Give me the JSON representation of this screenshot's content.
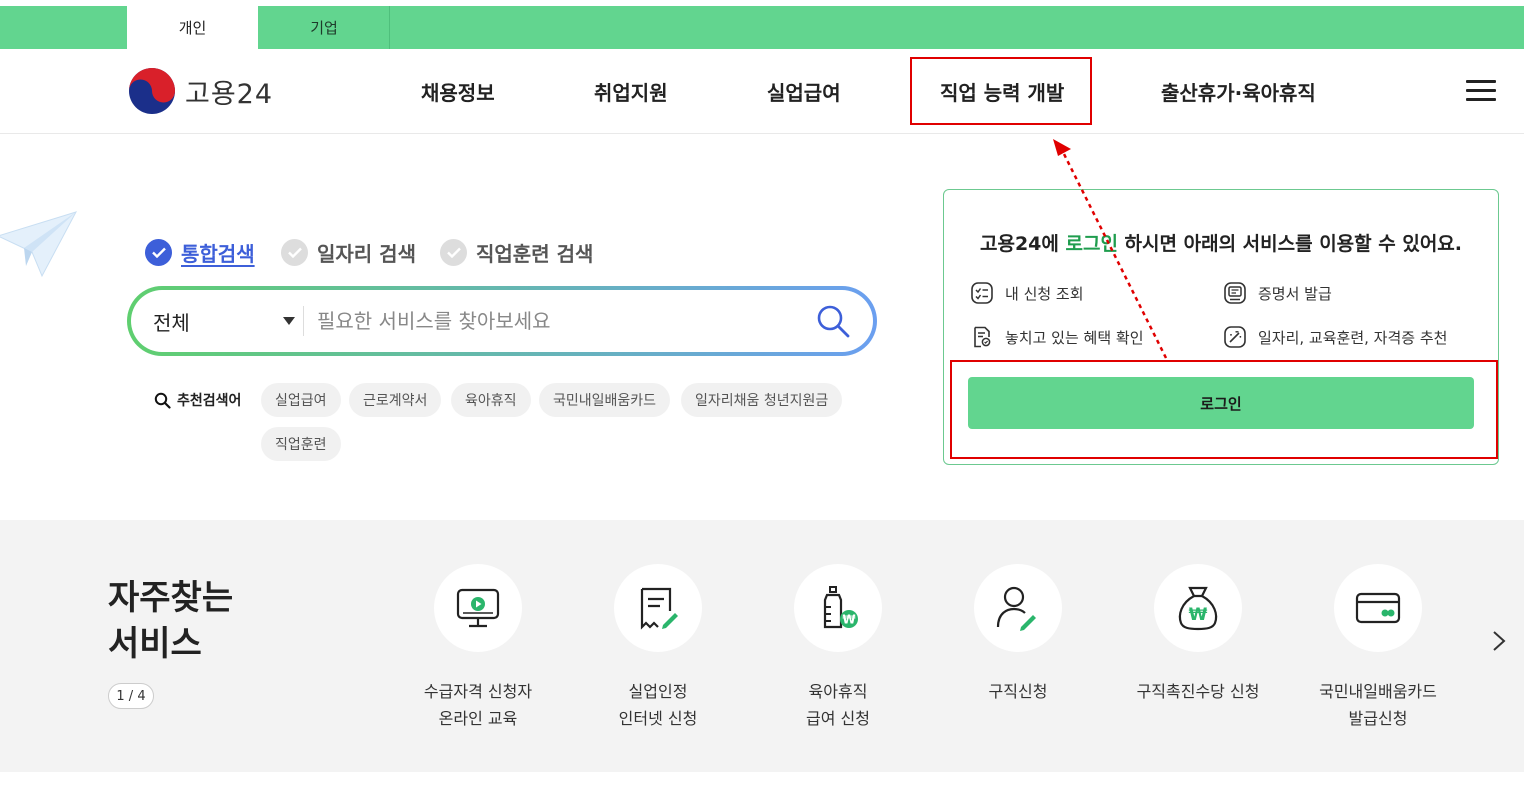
{
  "top_tabs": [
    {
      "label": "개인",
      "active": true
    },
    {
      "label": "기업",
      "active": false
    }
  ],
  "header": {
    "logo_text": "고용24",
    "nav": [
      "채용정보",
      "취업지원",
      "실업급여",
      "직업 능력 개발",
      "출산휴가·육아휴직"
    ]
  },
  "search": {
    "types": [
      {
        "label": "통합검색",
        "selected": true
      },
      {
        "label": "일자리 검색",
        "selected": false
      },
      {
        "label": "직업훈련 검색",
        "selected": false
      }
    ],
    "select_value": "전체",
    "placeholder": "필요한 서비스를 찾아보세요",
    "recommend_label": "추천검색어",
    "keywords": [
      "실업급여",
      "근로계약서",
      "육아휴직",
      "국민내일배움카드",
      "일자리채움 청년지원금",
      "직업훈련"
    ]
  },
  "login_panel": {
    "title_pre": "고용24에 ",
    "title_link": "로그인",
    "title_post": " 하시면 아래의 서비스를 이용할 수 있어요.",
    "services": [
      "내 신청 조회",
      "증명서 발급",
      "놓치고 있는 혜택 확인",
      "일자리, 교육훈련, 자격증 추천"
    ],
    "button": "로그인"
  },
  "frequent": {
    "title_line1": "자주찾는",
    "title_line2": "서비스",
    "pager": "1 / 4",
    "items": [
      {
        "line1": "수급자격 신청자",
        "line2": "온라인 교육",
        "icon": "monitor-play-icon"
      },
      {
        "line1": "실업인정",
        "line2": "인터넷 신청",
        "icon": "document-edit-icon"
      },
      {
        "line1": "육아휴직",
        "line2": "급여 신청",
        "icon": "baby-bottle-won-icon"
      },
      {
        "line1": "구직신청",
        "line2": "",
        "icon": "person-edit-icon"
      },
      {
        "line1": "구직촉진수당 신청",
        "line2": "",
        "icon": "money-bag-icon"
      },
      {
        "line1": "국민내일배움카드",
        "line2": "발급신청",
        "icon": "card-icon"
      }
    ]
  },
  "colors": {
    "brand_green": "#62d58f",
    "annotation_red": "#e00000"
  }
}
